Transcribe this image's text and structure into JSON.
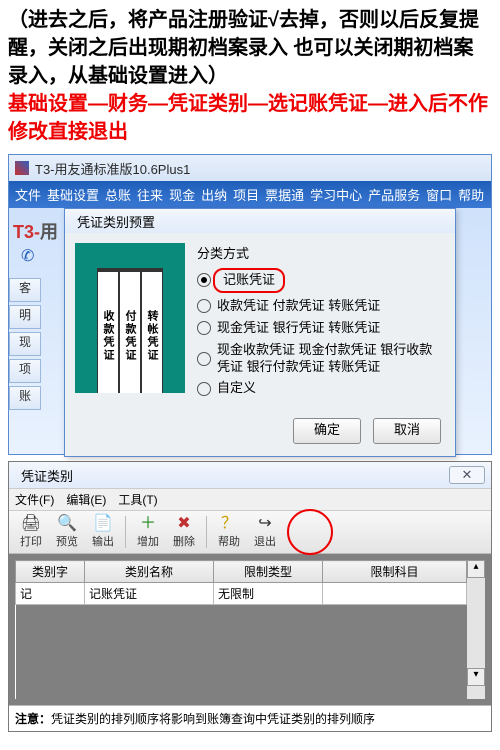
{
  "instructions": {
    "line1": "（进去之后，将产品注册验证√去掉，否则以后反复提醒，关闭之后出现期初档案录入  也可以关闭期初档案录入，从基础设置进入）",
    "line2": "基础设置—财务—凭证类别—选记账凭证—进入后不作修改直接退出"
  },
  "app": {
    "title": "T3-用友通标准版10.6Plus1",
    "brand": "T3-用",
    "menubar": [
      "文件",
      "基础设置",
      "总账",
      "往来",
      "现金",
      "出纳",
      "项目",
      "票据通",
      "学习中心",
      "产品服务",
      "窗口",
      "帮助"
    ],
    "sidebar": [
      "客",
      "明",
      "现",
      "项",
      "账"
    ]
  },
  "dialog": {
    "title": "凭证类别预置",
    "cols": [
      "收款凭证",
      "付款凭证",
      "转帐凭证"
    ],
    "group_label": "分类方式",
    "options": [
      {
        "label": "记账凭证"
      },
      {
        "label": "收款凭证 付款凭证 转账凭证"
      },
      {
        "label": "现金凭证 银行凭证 转账凭证"
      },
      {
        "label": "现金收款凭证 现金付款凭证 银行收款凭证 银行付款凭证 转账凭证"
      },
      {
        "label": "自定义"
      }
    ],
    "ok": "确定",
    "cancel": "取消"
  },
  "listwin": {
    "title": "凭证类别",
    "close": "✕",
    "menu": [
      "文件(F)",
      "编辑(E)",
      "工具(T)"
    ],
    "tools": {
      "print": "打印",
      "preview": "预览",
      "export": "输出",
      "add": "增加",
      "delete": "删除",
      "help": "帮助",
      "exit": "退出"
    },
    "columns": [
      "类别字",
      "类别名称",
      "限制类型",
      "限制科目"
    ],
    "row": {
      "c0": "记",
      "c1": "记账凭证",
      "c2": "无限制",
      "c3": ""
    },
    "note_label": "注意：",
    "note": "凭证类别的排列顺序将影响到账簿查询中凭证类别的排列顺序"
  }
}
